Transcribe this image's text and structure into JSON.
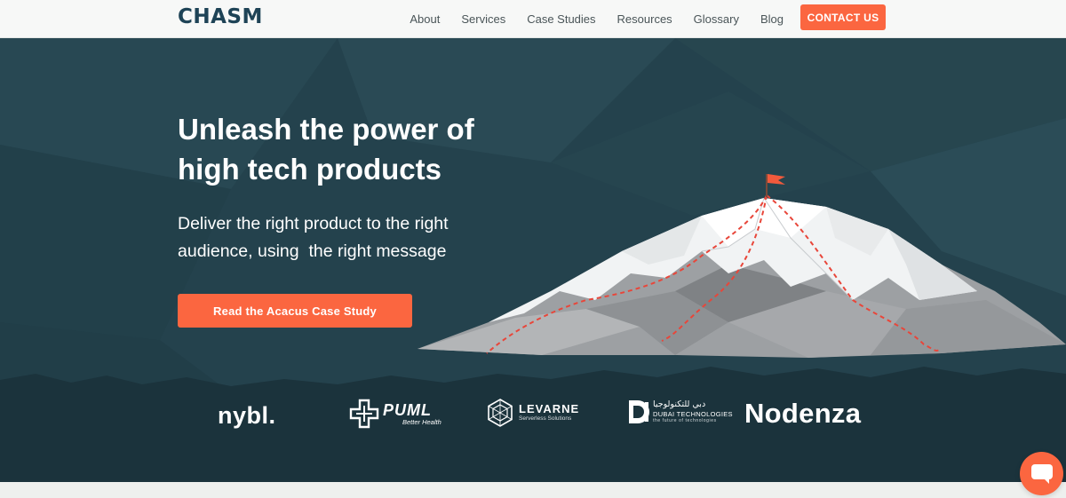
{
  "header": {
    "logo": "CHASM",
    "nav": [
      "About",
      "Services",
      "Case Studies",
      "Resources",
      "Glossary",
      "Blog"
    ],
    "cta": "CONTACT US"
  },
  "hero": {
    "title_line1": "Unleash the power of",
    "title_line2": "high tech products",
    "subtitle_line1": "Deliver the right product to the right",
    "subtitle_line2": "audience, using  the right message",
    "button": "Read the Acacus Case Study"
  },
  "clients": {
    "nybl": "nybl.",
    "puml_name": "PUML",
    "puml_tag": "Better Health",
    "levarne_name": "LEVARNE",
    "levarne_tag": "Serverless Solutions",
    "dubai_arabic": "دبي للتكنولوجيا",
    "dubai_name": "DUBAI TECHNOLOGIES",
    "dubai_tag": "the future of technologies",
    "nodenza": "Nodenza"
  },
  "colors": {
    "accent": "#fb6640",
    "hero_bg": "#24424d",
    "logo": "#1e4356"
  },
  "icons": {
    "chat": "chat-bubble-icon",
    "flag": "summit-flag-icon"
  }
}
